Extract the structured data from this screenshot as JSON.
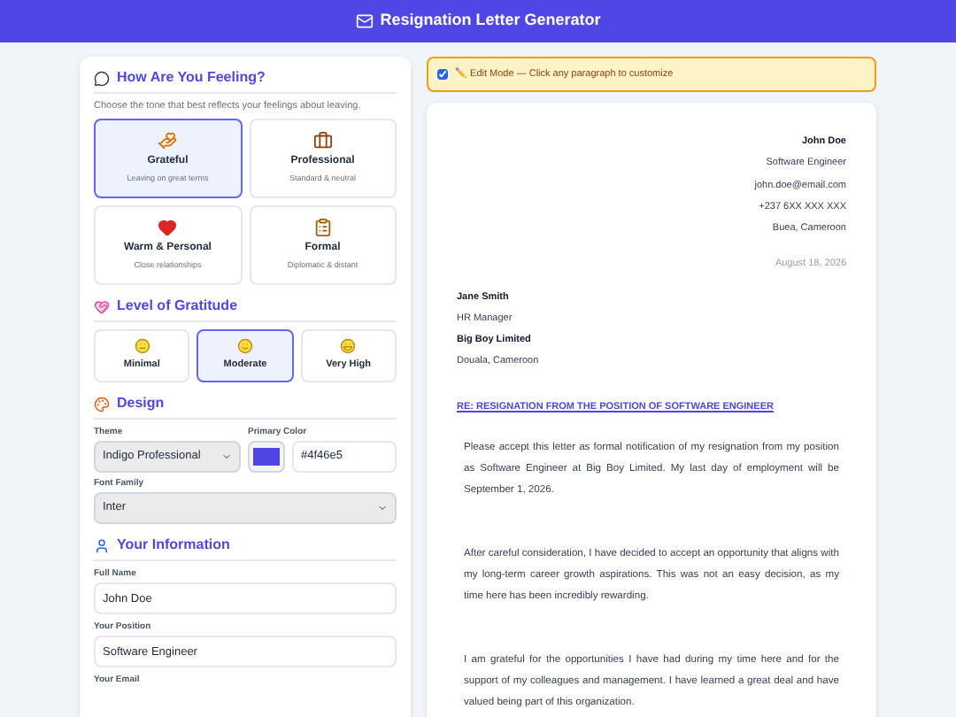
{
  "header": {
    "title": "Resignation Letter Generator"
  },
  "feeling": {
    "title": "How Are You Feeling?",
    "subtitle": "Choose the tone that best reflects your feelings about leaving.",
    "tones": [
      {
        "kind": "hands",
        "label": "Grateful",
        "caption": "Leaving on great terms",
        "selected": true
      },
      {
        "kind": "briefcase",
        "label": "Professional",
        "caption": "Standard & neutral",
        "selected": false
      },
      {
        "kind": "heart",
        "label": "Warm & Personal",
        "caption": "Close relationships",
        "selected": false
      },
      {
        "kind": "clipboard",
        "label": "Formal",
        "caption": "Diplomatic & distant",
        "selected": false
      }
    ]
  },
  "gratitude": {
    "title": "Level of Gratitude",
    "levels": [
      {
        "kind": "slight",
        "label": "Minimal",
        "selected": false
      },
      {
        "kind": "smile",
        "label": "Moderate",
        "selected": true
      },
      {
        "kind": "hug",
        "label": "Very High",
        "selected": false
      }
    ]
  },
  "design": {
    "title": "Design",
    "theme_label": "Theme",
    "theme": "Indigo Professional",
    "color_label": "Primary Color",
    "color": "#4f46e5",
    "color_text": "#4f46e5",
    "font_label": "Font Family",
    "font": "Inter"
  },
  "info": {
    "title": "Your Information",
    "fields": [
      {
        "label": "Full Name",
        "value": "John Doe"
      },
      {
        "label": "Your Position",
        "value": "Software Engineer"
      },
      {
        "label": "Your Email"
      }
    ]
  },
  "edit_mode": {
    "checked": true,
    "text": "✏️ Edit Mode — Click any paragraph to customize"
  },
  "letter": {
    "sender": [
      "John Doe",
      "Software Engineer",
      "john.doe@email.com",
      "+237 6XX XXX XXX",
      "Buea, Cameroon"
    ],
    "date": "August 18, 2026",
    "recipient": [
      {
        "text": "Jane Smith",
        "bold": true
      },
      {
        "text": "HR Manager",
        "bold": false
      },
      {
        "text": "Big Boy Limited",
        "bold": true
      },
      {
        "text": "Douala, Cameroon",
        "bold": false
      }
    ],
    "subject": "RE: RESIGNATION FROM THE POSITION OF SOFTWARE ENGINEER",
    "paragraphs": [
      "Please accept this letter as formal notification of my resignation from my position as Software Engineer at Big Boy Limited. My last day of employment will be September 1, 2026.",
      "After careful consideration, I have decided to accept an opportunity that aligns with my long-term career growth aspirations. This was not an easy decision, as my time here has been incredibly rewarding.",
      "I am grateful for the opportunities I have had during my time here and for the support of my colleagues and management. I have learned a great deal and have valued being part of this organization."
    ]
  }
}
